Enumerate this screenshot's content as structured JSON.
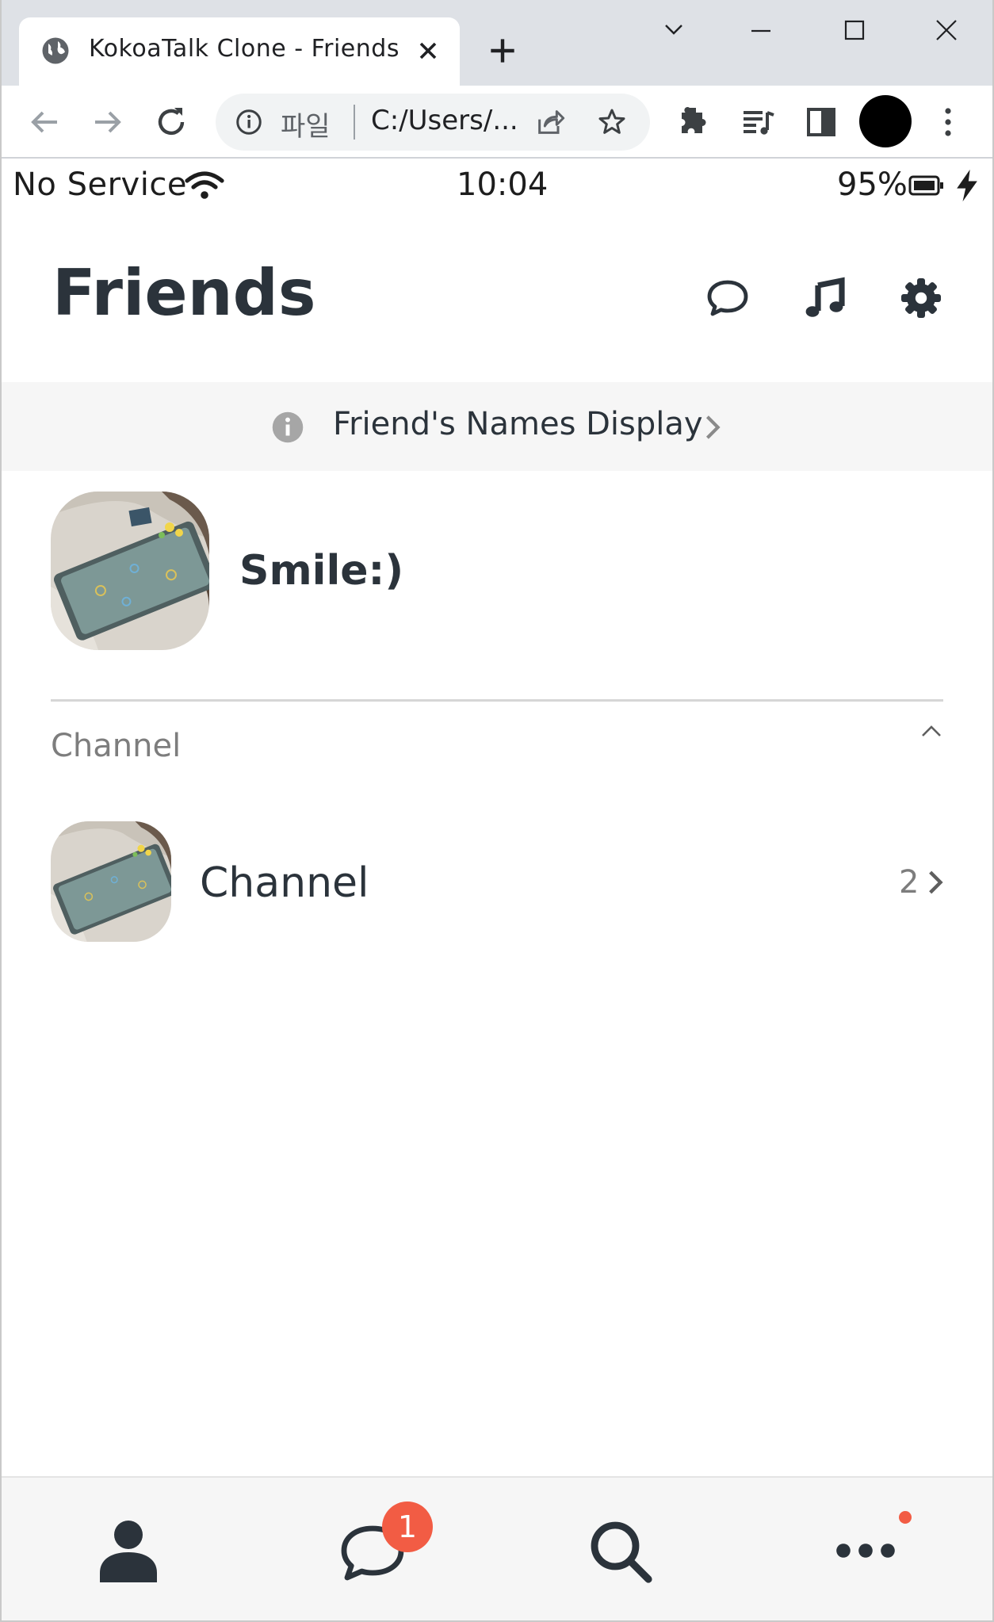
{
  "browser": {
    "tab_title": "KokoaTalk Clone - Friends",
    "omnibox_scheme": "파일",
    "omnibox_url": "C:/Users/..."
  },
  "status_bar": {
    "carrier": "No Service",
    "time": "10:04",
    "battery": "95%"
  },
  "header": {
    "title": "Friends"
  },
  "banner": {
    "text": "Friend's Names Display"
  },
  "profile": {
    "name": "Smile:)"
  },
  "channel_section": {
    "label": "Channel",
    "item_name": "Channel",
    "item_count": "2"
  },
  "bottom_nav": {
    "chats_badge": "1"
  },
  "colors": {
    "text_primary": "#2b333b",
    "text_muted": "#7d7d7d",
    "badge": "#f25c44",
    "banner_bg": "#f6f6f6",
    "chrome_bg": "#dee1e6"
  }
}
